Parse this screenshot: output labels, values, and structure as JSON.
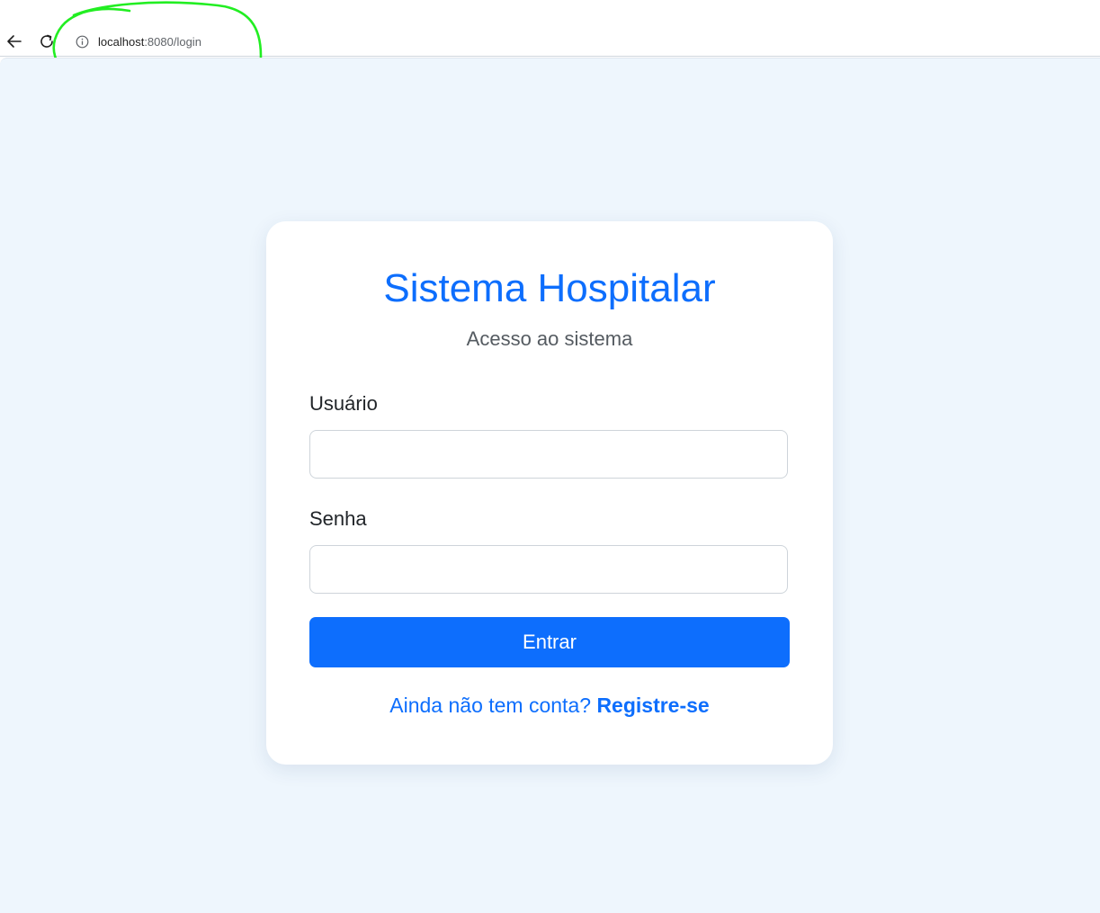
{
  "browser": {
    "url_host": "localhost",
    "url_rest": ":8080/login"
  },
  "login_card": {
    "title": "Sistema Hospitalar",
    "subtitle": "Acesso ao sistema",
    "username_label": "Usuário",
    "username_value": "",
    "password_label": "Senha",
    "password_value": "",
    "submit_label": "Entrar",
    "register_prompt": "Ainda não tem conta?",
    "register_link": "Registre-se"
  },
  "colors": {
    "accent": "#0d6efd",
    "page_background": "#eef6fd",
    "annotation": "#22ee22"
  }
}
